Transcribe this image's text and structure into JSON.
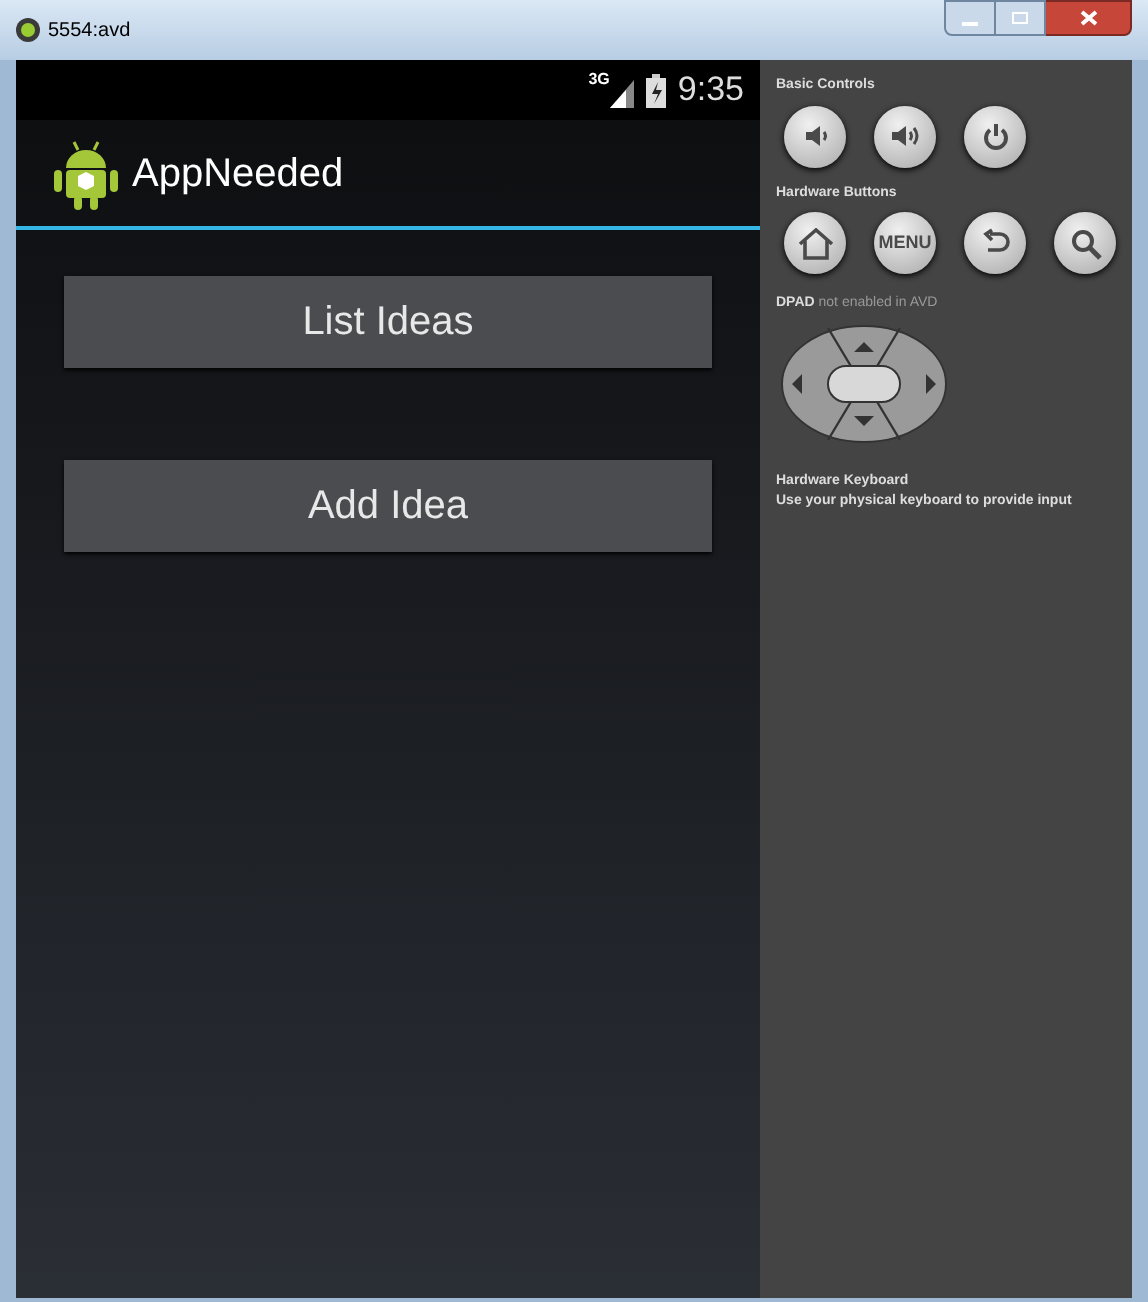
{
  "window": {
    "title": "5554:avd"
  },
  "status_bar": {
    "network": "3G",
    "time": "9:35"
  },
  "action_bar": {
    "title": "AppNeeded"
  },
  "buttons": [
    {
      "label": "List Ideas"
    },
    {
      "label": "Add Idea"
    }
  ],
  "controls_panel": {
    "basic_controls": {
      "title": "Basic Controls",
      "buttons": [
        {
          "kind": "volume-down"
        },
        {
          "kind": "volume-up"
        },
        {
          "kind": "power"
        }
      ]
    },
    "hardware_buttons": {
      "title": "Hardware Buttons",
      "buttons": [
        {
          "kind": "home"
        },
        {
          "kind": "menu",
          "label": "MENU"
        },
        {
          "kind": "back"
        },
        {
          "kind": "search"
        }
      ]
    },
    "dpad": {
      "title": "**DPAD** not enabled in AVD"
    },
    "keyboard": {
      "title": "Hardware Keyboard",
      "hint": "Use your physical keyboard to provide input"
    }
  }
}
